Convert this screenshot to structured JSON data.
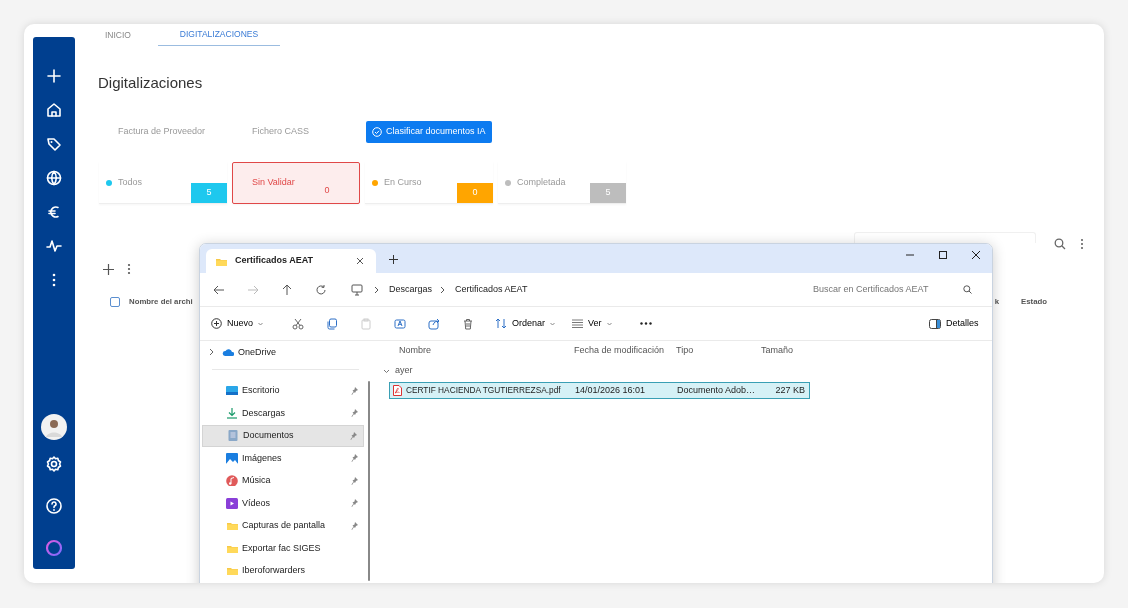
{
  "tabs": [
    {
      "label": "INICIO",
      "selected": false
    },
    {
      "label": "DIGITALIZACIONES",
      "selected": true
    }
  ],
  "page_title": "Digitalizaciones",
  "subtabs": [
    {
      "label": "Factura de Proveedor",
      "selected": false
    },
    {
      "label": "Fichero CASS",
      "selected": false
    },
    {
      "label": "Clasificar documentos IA",
      "selected": true
    }
  ],
  "status_filters": [
    {
      "label": "Todos",
      "count": "5",
      "color": "#1ec8ee",
      "selected": false
    },
    {
      "label": "Sin Validar",
      "count": "0",
      "color": "#e04848",
      "selected": true
    },
    {
      "label": "En Curso",
      "count": "0",
      "color": "#ffa500",
      "selected": false
    },
    {
      "label": "Completada",
      "count": "5",
      "color": "#bdbdbd",
      "selected": false
    }
  ],
  "table": {
    "select_all": {
      "checked": false
    },
    "columns": [
      "Nombre del archi",
      "k",
      "Estado"
    ]
  },
  "explorer": {
    "tab_title": "Certificados AEAT",
    "breadcrumb": [
      "Descargas",
      "Certificados AEAT"
    ],
    "search": {
      "placeholder": "Buscar en Certificados AEAT"
    },
    "toolbar": {
      "new": "Nuevo",
      "sort": "Ordenar",
      "view": "Ver",
      "details": "Detalles"
    },
    "nav_items": [
      {
        "label": "OneDrive",
        "kind": "cloud",
        "expanded": false,
        "pinned": false,
        "selected": false
      },
      {
        "label": "Escritorio",
        "kind": "desktop",
        "pinned": true,
        "selected": false
      },
      {
        "label": "Descargas",
        "kind": "download",
        "pinned": true,
        "selected": false
      },
      {
        "label": "Documentos",
        "kind": "documents",
        "pinned": true,
        "selected": true
      },
      {
        "label": "Imágenes",
        "kind": "pictures",
        "pinned": true,
        "selected": false
      },
      {
        "label": "Música",
        "kind": "music",
        "pinned": true,
        "selected": false
      },
      {
        "label": "Vídeos",
        "kind": "videos",
        "pinned": true,
        "selected": false
      },
      {
        "label": "Capturas de pantalla",
        "kind": "folder",
        "pinned": true,
        "selected": false
      },
      {
        "label": "Exportar fac SIGES",
        "kind": "folder",
        "pinned": false,
        "selected": false
      },
      {
        "label": "Iberoforwarders",
        "kind": "folder",
        "pinned": false,
        "selected": false
      }
    ],
    "columns": [
      "Nombre",
      "Fecha de modificación",
      "Tipo",
      "Tamaño"
    ],
    "groups": [
      {
        "label": "ayer",
        "expanded": true,
        "files": [
          {
            "name": "CERTIF HACIENDA TGUTIERREZSA.pdf",
            "modified": "14/01/2026 16:01",
            "type": "Documento Adob…",
            "size": "227 KB",
            "selected": true
          }
        ]
      }
    ]
  }
}
